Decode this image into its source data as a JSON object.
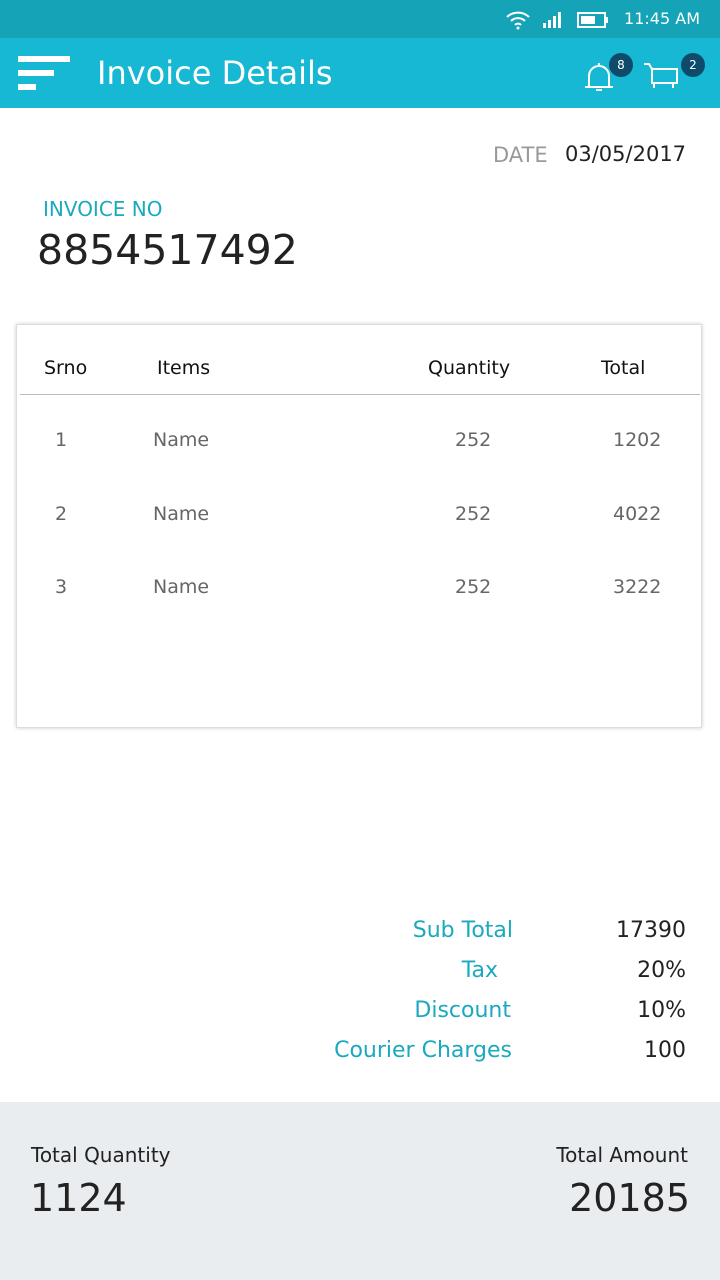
{
  "status_bar": {
    "time": "11:45 AM"
  },
  "app_bar": {
    "title": "Invoice Details",
    "notifications_count": "8",
    "cart_count": "2"
  },
  "date": {
    "label": "DATE",
    "value": "03/05/2017"
  },
  "invoice": {
    "label": "INVOICE NO",
    "number": "8854517492"
  },
  "table": {
    "headers": [
      "Srno",
      "Items",
      "Quantity",
      "Total"
    ],
    "rows": [
      [
        "1",
        "Name",
        "252",
        "1202"
      ],
      [
        "2",
        "Name",
        "252",
        "4022"
      ],
      [
        "3",
        "Name",
        "252",
        "3222"
      ]
    ]
  },
  "summary": [
    {
      "label": "Sub Total",
      "value": "17390"
    },
    {
      "label": "Tax",
      "value": "20%"
    },
    {
      "label": "Discount",
      "value": "10%"
    },
    {
      "label": "Courier Charges",
      "value": "100"
    }
  ],
  "footer": {
    "qty_label": "Total Quantity",
    "qty_value": "1124",
    "amount_label": "Total Amount",
    "amount_value": "20185"
  }
}
